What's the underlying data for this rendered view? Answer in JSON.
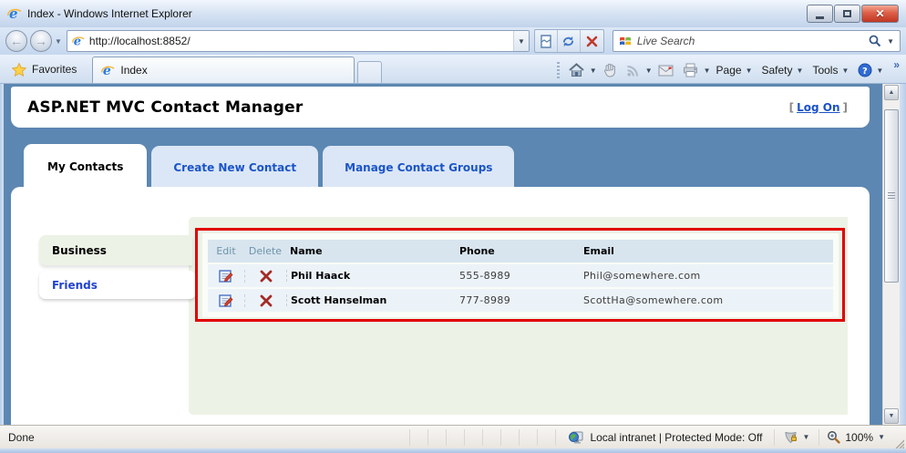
{
  "browser": {
    "title": "Index - Windows Internet Explorer",
    "address": {
      "url": "http://localhost:8852/"
    },
    "search": {
      "placeholder": "Live Search"
    },
    "favorites_label": "Favorites",
    "tab_title": "Index",
    "command_bar": {
      "page": "Page",
      "safety": "Safety",
      "tools": "Tools"
    }
  },
  "page": {
    "title": "ASP.NET MVC Contact Manager",
    "logon": {
      "open": "[",
      "label": "Log On",
      "close": "]"
    },
    "tabs": [
      {
        "label": "My Contacts",
        "active": true
      },
      {
        "label": "Create New Contact",
        "active": false
      },
      {
        "label": "Manage Contact Groups",
        "active": false
      }
    ],
    "groups": [
      {
        "label": "Business",
        "active": true
      },
      {
        "label": "Friends",
        "active": false
      }
    ],
    "table": {
      "headers": {
        "edit": "Edit",
        "delete": "Delete",
        "name": "Name",
        "phone": "Phone",
        "email": "Email"
      },
      "rows": [
        {
          "name": "Phil Haack",
          "phone": "555-8989",
          "email": "Phil@somewhere.com"
        },
        {
          "name": "Scott Hanselman",
          "phone": "777-8989",
          "email": "ScottHa@somewhere.com"
        }
      ]
    }
  },
  "status_bar": {
    "status": "Done",
    "zone": "Local intranet | Protected Mode: Off",
    "zoom": "100%"
  },
  "colors": {
    "body_blue": "#5c87b2",
    "annotation_red": "#e10000",
    "table_header": "#d8e5ef",
    "table_row": "#ecf3f8",
    "sage_panel": "#edf2e6"
  }
}
